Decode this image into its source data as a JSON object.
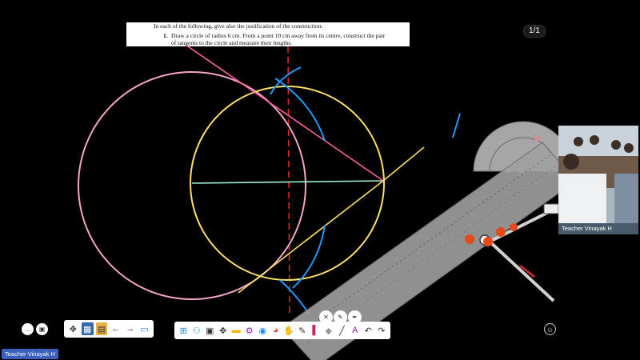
{
  "document": {
    "instruction": "In each of the following, give also the justification of the construction:",
    "question_number": "1.",
    "question_line1": "Draw a circle of radius 6 cm. From a point 10 cm away from its centre, construct the pair",
    "question_line2": "of tangents to the circle and measure their lengths."
  },
  "page_indicator": "1/1",
  "video": {
    "participant_name": "Teacher Vinayak H"
  },
  "bottom_label": "Teacher Vinayak H",
  "left_toolbar": {
    "icons": [
      "zoom-icon",
      "image-icon"
    ]
  },
  "nav_toolbar": {
    "icons": [
      "move-icon",
      "grid-tool-icon",
      "notes-icon",
      "arrow-left-icon",
      "arrow-right-icon",
      "slides-icon"
    ]
  },
  "main_toolbar": {
    "icons": [
      "windows-icon",
      "people-icon",
      "screenshot-icon",
      "move-icon",
      "folder-icon",
      "tools-icon",
      "browser-icon",
      "color-icon",
      "hand-icon",
      "pen-icon",
      "marker-icon",
      "eraser-icon",
      "line-icon",
      "text-icon",
      "undo-icon",
      "redo-icon"
    ]
  },
  "tool_controls": {
    "icons": [
      "close-circle-icon",
      "pencil-circle-icon",
      "pen-circle-icon"
    ]
  },
  "colors": {
    "pink_circle": "#f5a5c8",
    "yellow_circle": "#ffe066",
    "cyan_line": "#9ff0d0",
    "blue_arc": "#1f9bff",
    "red_bisector": "#e02424",
    "tangent_pink": "#ff5fa2",
    "tangent_yellow": "#ffe066",
    "ruler_gray": "#9a9a9a",
    "toolbar_bg": "#ffffff"
  }
}
